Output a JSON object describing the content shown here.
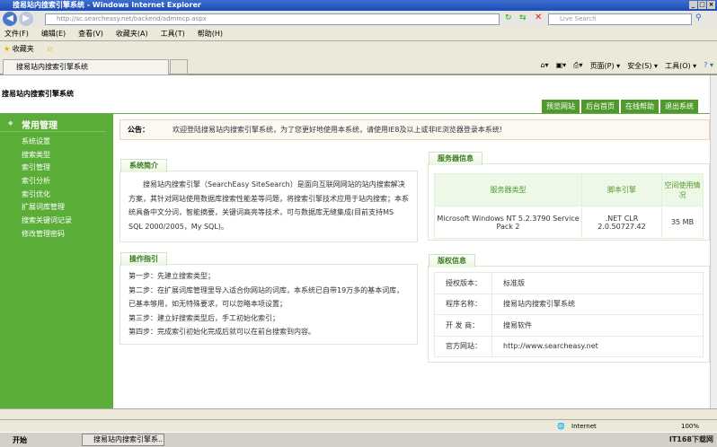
{
  "window": {
    "title": "搜易站内搜索引擎系统 - Windows Internet Explorer",
    "address": "http://sc.searcheasy.net/backend/admincp.aspx",
    "search_placeholder": "Live Search"
  },
  "menu": [
    "文件(F)",
    "编辑(E)",
    "查看(V)",
    "收藏夹(A)",
    "工具(T)",
    "帮助(H)"
  ],
  "favorites": {
    "label": "收藏夹"
  },
  "tab": {
    "label": "搜易站内搜索引擎系统"
  },
  "commandbar": {
    "page": "页面(P) ▾",
    "safety": "安全(S) ▾",
    "tools": "工具(O) ▾",
    "help": "? ▾"
  },
  "site": {
    "title": "搜易站内搜索引擎系统",
    "buttons": [
      "预览网站",
      "后台首页",
      "在线帮助",
      "退出系统"
    ]
  },
  "sidebar": {
    "heading": "常用管理",
    "items": [
      "系统设置",
      "搜索类型",
      "索引管理",
      "索引分析",
      "索引优化",
      "扩展词库管理",
      "搜索关键词记录",
      "修改管理密码"
    ]
  },
  "notice": {
    "label": "公告：",
    "text": "欢迎登陆搜易站内搜索引擎系统，为了您更好地使用本系统，请使用IE8及以上或非IE浏览器登录本系统!"
  },
  "intro": {
    "tab": "系统简介",
    "text": "　　搜易站内搜索引擎（SearchEasy SiteSearch）是面向互联网网站的站内搜索解决方案，其针对网站使用数据库搜索性能差等问题，将搜索引擎技术应用于站内搜索；本系统具备中文分词，智能摘要，关键词高亮等技术，可与数据库无缝集成(目前支持MS SQL 2000/2005，My SQL)。"
  },
  "guide": {
    "tab": "操作指引",
    "steps": [
      "第一步：先建立搜索类型；",
      "第二步：在扩展词库管理里导入适合你网站的词库，本系统已自带19万多的基本词库，已基本够用，如无特殊要求，可以忽略本项设置；",
      "第三步：建立好搜索类型后，手工初始化索引；",
      "第四步：完成索引初始化完成后就可以在前台搜索到内容。"
    ]
  },
  "server": {
    "tab": "服务器信息",
    "headers": [
      "服务器类型",
      "脚本引擎",
      "空间使用情况"
    ],
    "row": [
      "Microsoft Windows NT 5.2.3790 Service Pack 2",
      ".NET CLR 2.0.50727.42",
      "35 MB"
    ]
  },
  "copyright": {
    "tab": "版权信息",
    "rows": [
      [
        "授权版本：",
        "标准版"
      ],
      [
        "程序名称：",
        "搜易站内搜索引擎系统"
      ],
      [
        "开 发 商：",
        "搜易软件"
      ],
      [
        "官方网站：",
        "http://www.searcheasy.net"
      ]
    ]
  },
  "status": {
    "zone": "Internet",
    "zoom": "100%"
  },
  "taskbar": {
    "start": "开始",
    "task": "搜易站内搜索引擎系...",
    "tray": "IT168下载网"
  }
}
